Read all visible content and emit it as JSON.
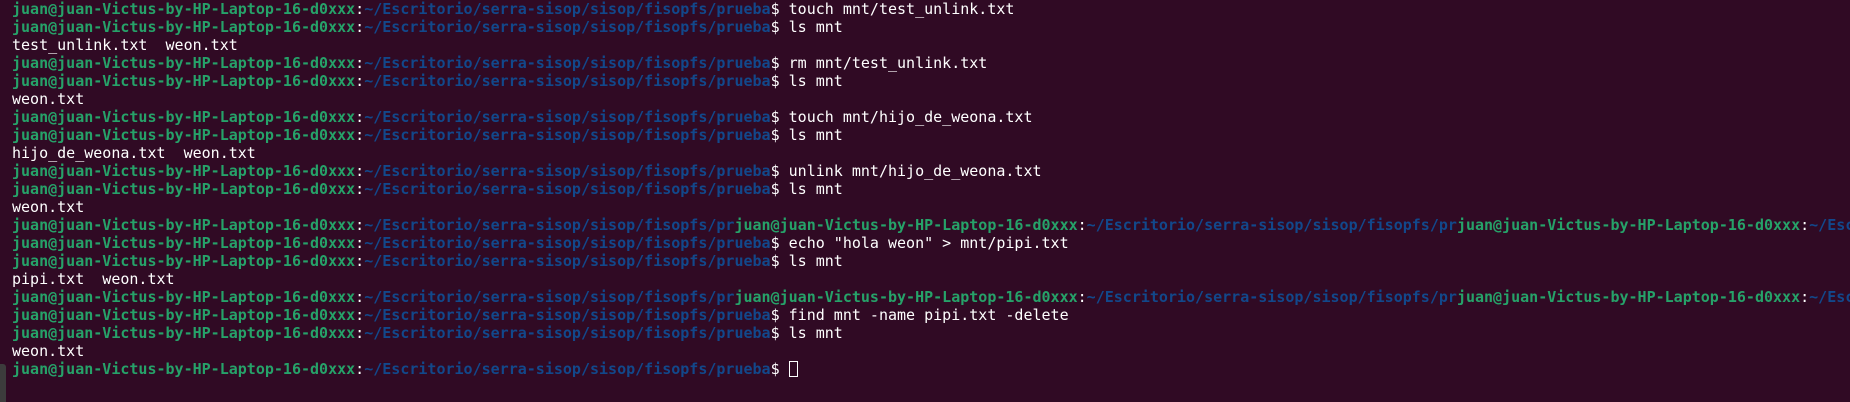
{
  "terminal": {
    "user_host": "juan@juan-Victus-by-HP-Laptop-16-d0xxx",
    "cwd": "~/Escritorio/serra-sisop/sisop/fisopfs/prueba",
    "cwd_truncated": "~/Escritorio/serra-sisop/sisop/fisopfs/pr",
    "cwd_truncated_last": "~/Esc",
    "colors": {
      "background": "#300a24",
      "user": "#26a269",
      "path": "#12488b",
      "text": "#ffffff"
    },
    "lines": [
      {
        "type": "prompt",
        "command": "touch mnt/test_unlink.txt"
      },
      {
        "type": "prompt",
        "command": "ls mnt"
      },
      {
        "type": "output",
        "text": "test_unlink.txt  weon.txt"
      },
      {
        "type": "prompt",
        "command": "rm mnt/test_unlink.txt"
      },
      {
        "type": "prompt",
        "command": "ls mnt"
      },
      {
        "type": "output",
        "text": "weon.txt"
      },
      {
        "type": "prompt",
        "command": "touch mnt/hijo_de_weona.txt"
      },
      {
        "type": "prompt",
        "command": "ls mnt"
      },
      {
        "type": "output",
        "text": "hijo_de_weona.txt  weon.txt"
      },
      {
        "type": "prompt",
        "command": "unlink mnt/hijo_de_weona.txt"
      },
      {
        "type": "prompt",
        "command": "ls mnt"
      },
      {
        "type": "output",
        "text": "weon.txt"
      },
      {
        "type": "garbled"
      },
      {
        "type": "prompt",
        "command": "echo \"hola weon\" > mnt/pipi.txt"
      },
      {
        "type": "prompt",
        "command": "ls mnt"
      },
      {
        "type": "output",
        "text": "pipi.txt  weon.txt"
      },
      {
        "type": "garbled"
      },
      {
        "type": "prompt",
        "command": "find mnt -name pipi.txt -delete"
      },
      {
        "type": "prompt",
        "command": "ls mnt"
      },
      {
        "type": "output",
        "text": "weon.txt"
      },
      {
        "type": "prompt",
        "command": "",
        "cursor": true
      }
    ]
  }
}
